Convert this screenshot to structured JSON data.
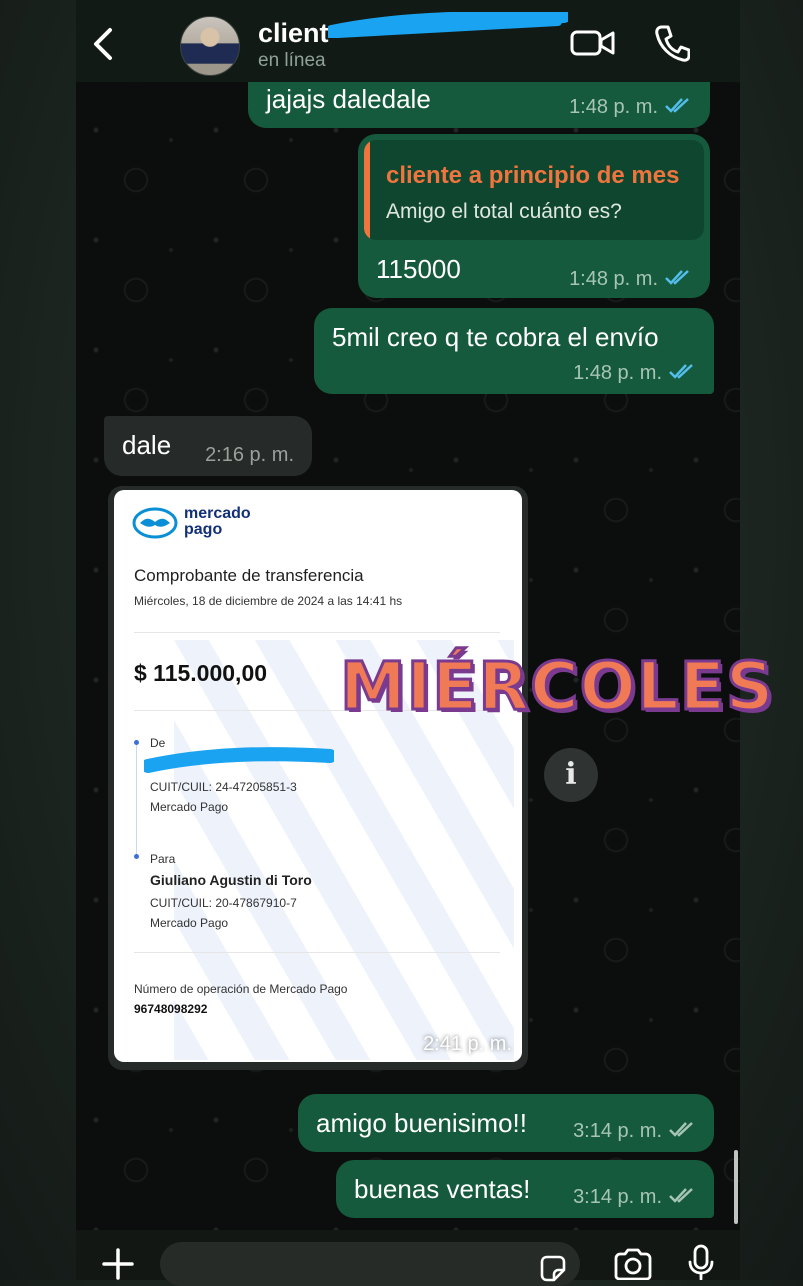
{
  "header": {
    "contact_name": "client",
    "status": "en línea"
  },
  "messages": [
    {
      "id": "m1",
      "text": "jajajs daledale",
      "time": "1:48 p. m.",
      "direction": "out",
      "read": true
    },
    {
      "id": "m2",
      "quote_name": "cliente a principio de mes",
      "quote_text": "Amigo el total cuánto es?",
      "text": "115000",
      "time": "1:48 p. m.",
      "direction": "out",
      "read": true
    },
    {
      "id": "m3",
      "text": "5mil creo q te cobra el envío",
      "time": "1:48 p. m.",
      "direction": "out",
      "read": true
    },
    {
      "id": "m4",
      "text": "dale",
      "time": "2:16 p. m.",
      "direction": "in"
    },
    {
      "id": "m7",
      "text": "amigo buenisimo!!",
      "time": "3:14 p. m.",
      "direction": "out",
      "read": false
    },
    {
      "id": "m8",
      "text": "buenas ventas!",
      "time": "3:14 p. m.",
      "direction": "out",
      "read": false
    }
  ],
  "receipt": {
    "brand_line1": "mercado",
    "brand_line2": "pago",
    "title": "Comprobante de transferencia",
    "date": "Miércoles, 18 de diciembre de 2024 a las 14:41 hs",
    "amount": "$ 115.000,00",
    "from_label": "De",
    "from_cuit": "CUIT/CUIL: 24-47205851-3",
    "from_bank": "Mercado Pago",
    "to_label": "Para",
    "to_name": "Giuliano Agustin di Toro",
    "to_cuit": "CUIT/CUIL: 20-47867910-7",
    "to_bank": "Mercado Pago",
    "op_label": "Número de operación de Mercado Pago",
    "op_number": "96748098292",
    "time": "2:41 p. m."
  },
  "sticker_text": "MIÉRCOLES",
  "info_icon": "i",
  "colors": {
    "outgoing_bubble": "#155a3c",
    "incoming_bubble": "#262a28",
    "quote_accent": "#f0743d",
    "read_ticks": "#53bdeb",
    "unread_ticks": "#a7c5b4"
  }
}
